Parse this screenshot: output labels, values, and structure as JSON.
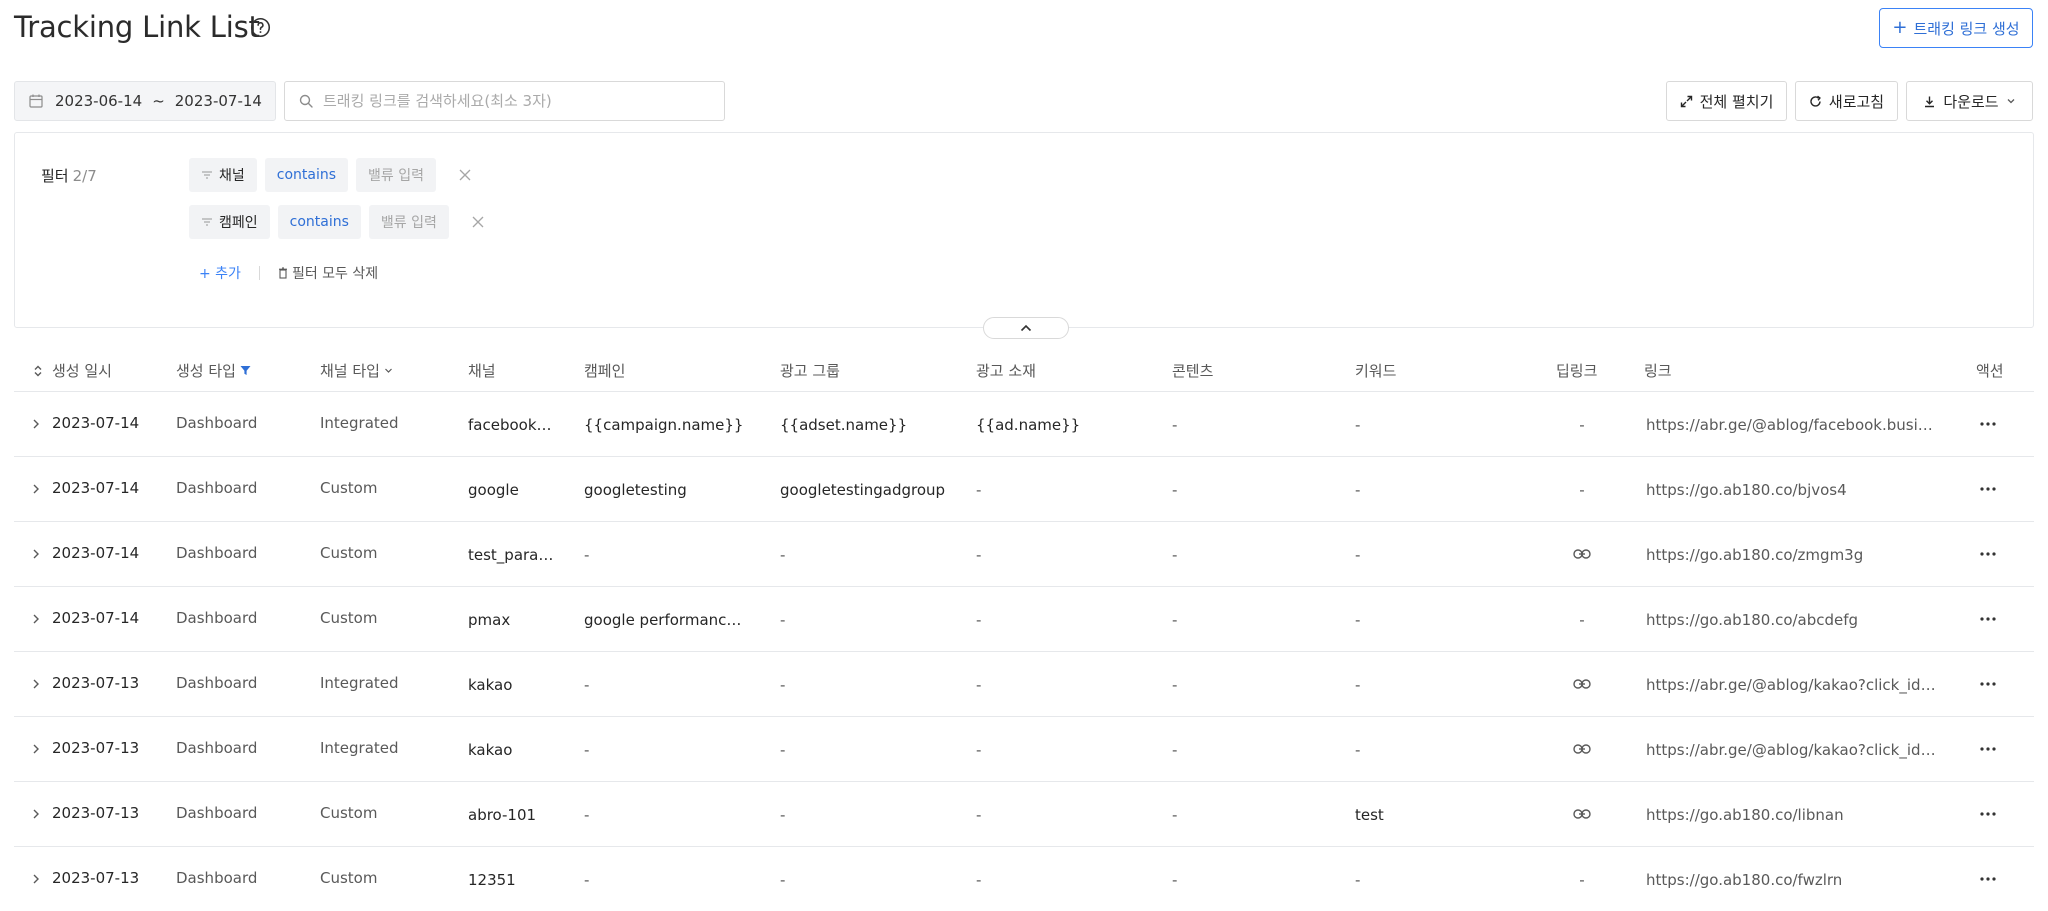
{
  "header": {
    "title": "Tracking Link List",
    "create_label": "트래킹 링크 생성"
  },
  "toolbar": {
    "date_start": "2023-06-14",
    "date_sep": "~",
    "date_end": "2023-07-14",
    "search_placeholder": "트래킹 링크를 검색하세요(최소 3자)",
    "expand_all_label": "전체 펼치기",
    "refresh_label": "새로고침",
    "download_label": "다운로드"
  },
  "filter": {
    "label": "필터",
    "count": "2/7",
    "rows": [
      {
        "field": "채널",
        "op": "contains",
        "value_placeholder": "밸류 입력"
      },
      {
        "field": "캠페인",
        "op": "contains",
        "value_placeholder": "밸류 입력"
      }
    ],
    "add_label": "+ 추가",
    "clear_label": "필터 모두 삭제"
  },
  "table": {
    "columns": [
      "생성 일시",
      "생성 타입",
      "채널 타입",
      "채널",
      "캠페인",
      "광고 그룹",
      "광고 소재",
      "콘텐츠",
      "키워드",
      "딥링크",
      "링크",
      "액션"
    ],
    "rows": [
      {
        "date": "2023-07-14",
        "type": "Dashboard",
        "ctype": "Integrated",
        "channel": "facebook.…",
        "campaign": "{{campaign.name}}",
        "adgroup": "{{adset.name}}",
        "ad": "{{ad.name}}",
        "contents": "-",
        "keyword": "-",
        "deeplink": "-",
        "link": "https://abr.ge/@ablog/facebook.busin…"
      },
      {
        "date": "2023-07-14",
        "type": "Dashboard",
        "ctype": "Custom",
        "channel": "google",
        "campaign": "googletesting",
        "adgroup": "googletestingadgroup",
        "ad": "-",
        "contents": "-",
        "keyword": "-",
        "deeplink": "-",
        "link": "https://go.ab180.co/bjvos4"
      },
      {
        "date": "2023-07-14",
        "type": "Dashboard",
        "ctype": "Custom",
        "channel": "test_para…",
        "campaign": "-",
        "adgroup": "-",
        "ad": "-",
        "contents": "-",
        "keyword": "-",
        "deeplink": "link-icon",
        "link": "https://go.ab180.co/zmgm3g"
      },
      {
        "date": "2023-07-14",
        "type": "Dashboard",
        "ctype": "Custom",
        "channel": "pmax",
        "campaign": "google performance …",
        "adgroup": "-",
        "ad": "-",
        "contents": "-",
        "keyword": "-",
        "deeplink": "-",
        "link": "https://go.ab180.co/abcdefg"
      },
      {
        "date": "2023-07-13",
        "type": "Dashboard",
        "ctype": "Integrated",
        "channel": "kakao",
        "campaign": "-",
        "adgroup": "-",
        "ad": "-",
        "contents": "-",
        "keyword": "-",
        "deeplink": "link-icon",
        "link": "https://abr.ge/@ablog/kakao?click_id=…"
      },
      {
        "date": "2023-07-13",
        "type": "Dashboard",
        "ctype": "Integrated",
        "channel": "kakao",
        "campaign": "-",
        "adgroup": "-",
        "ad": "-",
        "contents": "-",
        "keyword": "-",
        "deeplink": "link-icon",
        "link": "https://abr.ge/@ablog/kakao?click_id=…"
      },
      {
        "date": "2023-07-13",
        "type": "Dashboard",
        "ctype": "Custom",
        "channel": "abro-101",
        "campaign": "-",
        "adgroup": "-",
        "ad": "-",
        "contents": "-",
        "keyword": "test",
        "deeplink": "link-icon",
        "link": "https://go.ab180.co/libnan"
      },
      {
        "date": "2023-07-13",
        "type": "Dashboard",
        "ctype": "Custom",
        "channel": "12351",
        "campaign": "-",
        "adgroup": "-",
        "ad": "-",
        "contents": "-",
        "keyword": "-",
        "deeplink": "-",
        "link": "https://go.ab180.co/fwzlrn"
      }
    ]
  },
  "colors": {
    "accent": "#2f6fd6",
    "border": "#e6e8eb",
    "chip_bg": "#f2f3f5"
  }
}
